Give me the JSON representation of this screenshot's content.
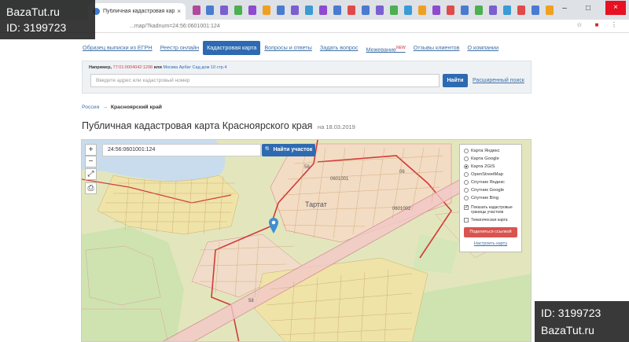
{
  "browser": {
    "tab_title": "Публичная кадастровая карт",
    "tab_close": "×",
    "url": "...map/?kadnum=24:56:0601001:124",
    "window_controls": [
      "–",
      "□",
      "×"
    ],
    "address_icons": [
      "☆",
      "■",
      "⋮"
    ]
  },
  "nav": {
    "items": [
      {
        "label": "Образец выписки из ЕГРН",
        "active": false
      },
      {
        "label": "Реестр онлайн",
        "active": false
      },
      {
        "label": "Кадастровая карта",
        "active": true
      },
      {
        "label": "Вопросы и ответы",
        "active": false
      },
      {
        "label": "Задать вопрос",
        "active": false
      },
      {
        "label": "Межевание",
        "active": false,
        "badge": "NEW"
      },
      {
        "label": "Отзывы клиентов",
        "active": false
      },
      {
        "label": "О компании",
        "active": false
      }
    ]
  },
  "search": {
    "example_prefix": "Например,",
    "example_kadnum": "77:01:0004042:1298",
    "example_or": "или",
    "example_address": "Москва Арбат Сад дом 10 стр.4",
    "placeholder": "Введите адрес или кадастровый номер",
    "button": "Найти",
    "advanced": "Расширенный поиск"
  },
  "breadcrumb": {
    "root": "Россия",
    "separator": "→",
    "current": "Красноярский край"
  },
  "page": {
    "title": "Публичная кадастровая карта Красноярского края",
    "date": "на 18.03.2019"
  },
  "map": {
    "zoom_in": "+",
    "zoom_out": "−",
    "fullscreen": "⤢",
    "print": "⎙",
    "search_value": "24:56:0601001:124",
    "find_button": "Найти участок",
    "place_name": "Тартат",
    "parcel_labels": [
      "58",
      "0601001",
      "0601002",
      "06",
      "58"
    ],
    "layers": [
      {
        "label": "Карта Яндекс",
        "checked": false
      },
      {
        "label": "Карта Google",
        "checked": false
      },
      {
        "label": "Карта 2GIS",
        "checked": true
      },
      {
        "label": "OpenStreetMap",
        "checked": false
      },
      {
        "label": "Спутник Яндекс",
        "checked": false
      },
      {
        "label": "Спутник Google",
        "checked": false
      },
      {
        "label": "Спутник Bing",
        "checked": false
      }
    ],
    "options": [
      {
        "label": "Показать кадастровые границы участков",
        "checked": true
      },
      {
        "label": "Тематическая карта",
        "checked": false
      }
    ],
    "share_button": "Поделиться ссылкой",
    "setup_link": "Настроить карту"
  },
  "watermarks": {
    "top_site": "BazaTut.ru",
    "top_id": "ID: 3199723",
    "bottom_id": "ID: 3199723",
    "bottom_site": "BazaTut.ru"
  }
}
